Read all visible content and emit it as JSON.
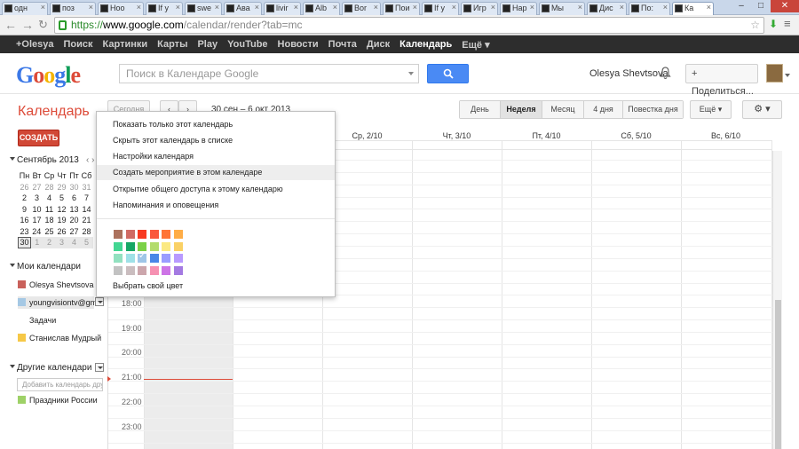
{
  "browser": {
    "tabs": [
      {
        "label": "одн"
      },
      {
        "label": "поз"
      },
      {
        "label": "Ноо"
      },
      {
        "label": "If y"
      },
      {
        "label": "swe"
      },
      {
        "label": "Ава"
      },
      {
        "label": "livir"
      },
      {
        "label": "Alb"
      },
      {
        "label": "Bor"
      },
      {
        "label": "Пои"
      },
      {
        "label": "If y"
      },
      {
        "label": "Игр"
      },
      {
        "label": "Нар"
      },
      {
        "label": "Мы"
      },
      {
        "label": "Дис"
      },
      {
        "label": "По:"
      },
      {
        "label": "Ка"
      }
    ],
    "url_scheme": "https://",
    "url_host": "www.google.com",
    "url_path": "/calendar/render?tab=mc"
  },
  "gbar": {
    "items": [
      "+Olesya",
      "Поиск",
      "Картинки",
      "Карты",
      "Play",
      "YouTube",
      "Новости",
      "Почта",
      "Диск",
      "Календарь",
      "Ещё ▾"
    ],
    "active": "Календарь"
  },
  "header": {
    "logo": "Google",
    "search_placeholder": "Поиск в Календаре Google",
    "user_name": "Olesya Shevtsova",
    "share_label": "+ Поделиться..."
  },
  "app": {
    "title": "Календарь",
    "today_label": "Сегодня",
    "prev_label": "‹",
    "next_label": "›",
    "range": "30 сен – 6 окт 2013",
    "views": [
      "День",
      "Неделя",
      "Месяц",
      "4 дня",
      "Повестка дня"
    ],
    "active_view": "Неделя",
    "more_label": "Ещё ▾",
    "gear_label": "⚙ ▾",
    "create_label": "СОЗДАТЬ"
  },
  "minical": {
    "title": "Сентябрь 2013",
    "nav": "‹ ›",
    "weekdays": [
      "Пн",
      "Вт",
      "Ср",
      "Чт",
      "Пт",
      "Сб"
    ],
    "weeks": [
      [
        "26",
        "27",
        "28",
        "29",
        "30",
        "31"
      ],
      [
        "2",
        "3",
        "4",
        "5",
        "6",
        "7"
      ],
      [
        "9",
        "10",
        "11",
        "12",
        "13",
        "14"
      ],
      [
        "16",
        "17",
        "18",
        "19",
        "20",
        "21"
      ],
      [
        "23",
        "24",
        "25",
        "26",
        "27",
        "28"
      ],
      [
        "30",
        "1",
        "2",
        "3",
        "4",
        "5"
      ]
    ]
  },
  "my_calendars": {
    "title": "Мои календари",
    "items": [
      {
        "label": "Olesya Shevtsova",
        "color": "#c9615b"
      },
      {
        "label": "youngvisiontv@gma",
        "color": "#a5c8e4"
      },
      {
        "label": "Задачи",
        "color": ""
      },
      {
        "label": "Станислав Мудрый",
        "color": "#f6c847"
      }
    ]
  },
  "other_calendars": {
    "title": "Другие календари",
    "add_placeholder": "Добавить календарь друга",
    "items": [
      {
        "label": "Праздники России",
        "color": "#9ed167"
      }
    ]
  },
  "week": {
    "days": [
      "Ср, 2/10",
      "Чт, 3/10",
      "Пт, 4/10",
      "Сб, 5/10",
      "Вс, 6/10"
    ],
    "times": [
      "18:00",
      "19:00",
      "20:00",
      "21:00",
      "22:00",
      "23:00"
    ]
  },
  "menu": {
    "items": [
      "Показать только этот календарь",
      "Скрыть этот календарь в списке",
      "Настройки календаря",
      "Создать мероприятие в этом календаре",
      "Открытие общего доступа к этому календарю",
      "Напоминания и оповещения"
    ],
    "highlighted": 3,
    "custom_color": "Выбрать свой цвет",
    "palette": [
      [
        "#ac725e",
        "#d06b64",
        "#f83a22",
        "#fa573c",
        "#ff7537",
        "#ffad46"
      ],
      [
        "#42d692",
        "#16a765",
        "#7bd148",
        "#b3dc6c",
        "#fbe983",
        "#fad165"
      ],
      [
        "#92e1c0",
        "#9fe1e7",
        "#9fc6e7",
        "#4986e7",
        "#9a9cff",
        "#b99aff"
      ],
      [
        "#c2c2c2",
        "#cabdbf",
        "#cca6ac",
        "#f691b2",
        "#cd74e6",
        "#a47ae2"
      ]
    ],
    "selected_color": "#9fc6e7"
  }
}
